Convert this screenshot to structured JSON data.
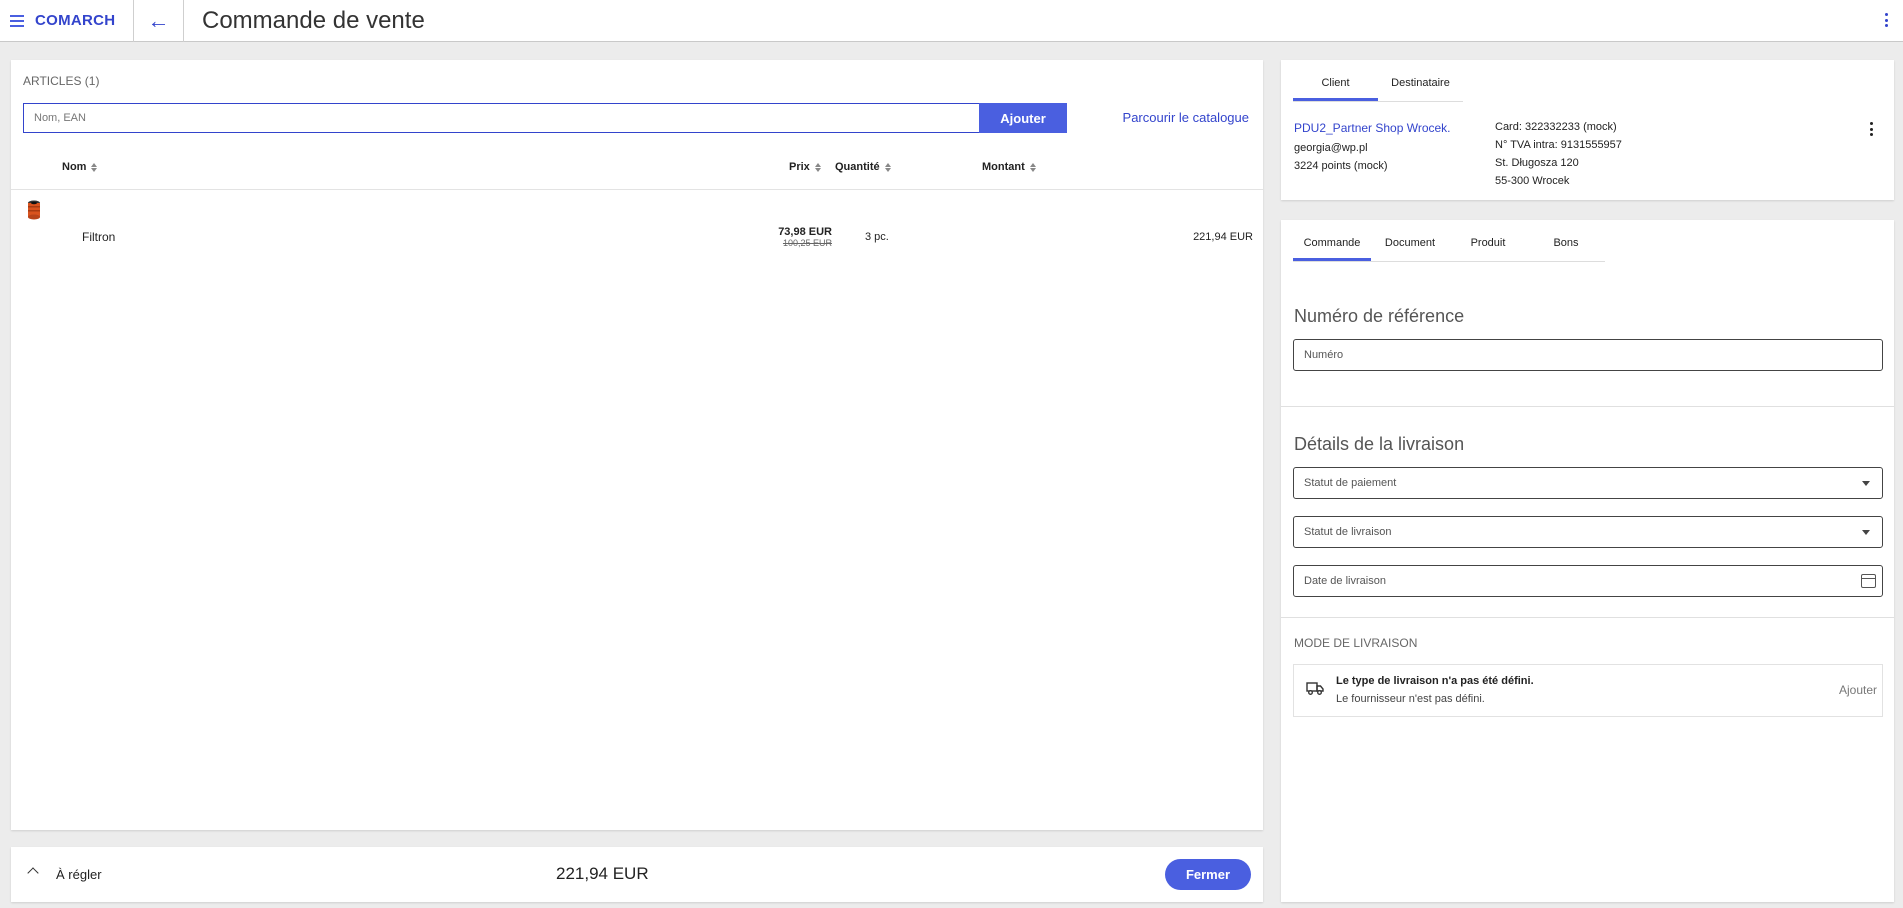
{
  "header": {
    "logo": "COMARCH",
    "title": "Commande de vente"
  },
  "articles": {
    "caption": "ARTICLES (1)",
    "search_placeholder": "Nom, EAN",
    "add_label": "Ajouter",
    "catalog_link": "Parcourir le catalogue",
    "columns": {
      "name": "Nom",
      "price": "Prix",
      "quantity": "Quantité",
      "amount": "Montant"
    },
    "rows": [
      {
        "name": "Filtron",
        "price": "73,98 EUR",
        "old_price": "100,25 EUR",
        "quantity": "3 pc.",
        "amount": "221,94 EUR"
      }
    ]
  },
  "summary": {
    "label": "À régler",
    "total": "221,94 EUR",
    "close_label": "Fermer"
  },
  "client": {
    "tabs": [
      "Client",
      "Destinataire"
    ],
    "active_tab": 0,
    "name": "PDU2_Partner Shop Wrocek.",
    "email": "georgia@wp.pl",
    "points": "3224 points (mock)",
    "card": "Card: 322332233 (mock)",
    "vat": "N° TVA intra: 9131555957",
    "street": "St. Długosza 120",
    "city": "55-300 Wrocek"
  },
  "order": {
    "tabs": [
      "Commande",
      "Document",
      "Produit",
      "Bons"
    ],
    "active_tab": 0,
    "reference_title": "Numéro de référence",
    "reference_placeholder": "Numéro",
    "delivery_title": "Détails de la livraison",
    "payment_status": "Statut de paiement",
    "delivery_status": "Statut de livraison",
    "delivery_date": "Date de livraison",
    "mode_caption": "MODE DE LIVRAISON",
    "delivery_type_title": "Le type de livraison n'a pas été défini.",
    "delivery_type_sub": "Le fournisseur n'est pas défini.",
    "delivery_add": "Ajouter"
  },
  "colors": {
    "accent": "#4a5fe0",
    "brand": "#3344cc"
  },
  "icons": [
    "menu-icon",
    "back-arrow-icon",
    "more-vert-icon",
    "sort-icon",
    "chevron-up-icon",
    "dropdown-caret-icon",
    "calendar-icon",
    "truck-icon"
  ]
}
